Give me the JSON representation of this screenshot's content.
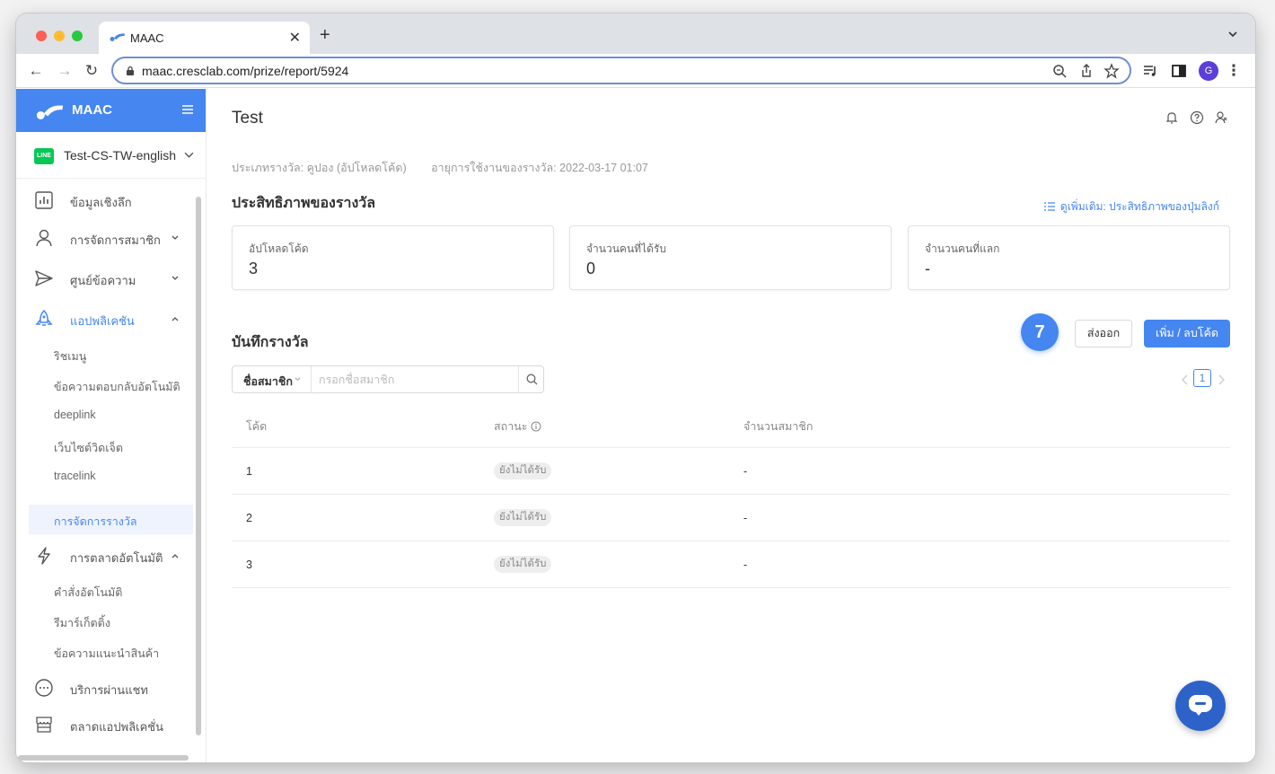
{
  "browser": {
    "tab_title": "MAAC",
    "url": "maac.cresclab.com/prize/report/5924",
    "profile_initial": "G"
  },
  "sidebar": {
    "brand": "MAAC",
    "account": "Test-CS-TW-english",
    "line_badge": "LINE",
    "items": [
      {
        "label": "ข้อมูลเชิงลึก",
        "icon": "bar-chart-icon"
      },
      {
        "label": "การจัดการสมาชิก",
        "icon": "user-icon"
      },
      {
        "label": "ศูนย์ข้อความ",
        "icon": "send-icon"
      },
      {
        "label": "แอปพลิเคชัน",
        "icon": "rocket-icon"
      },
      {
        "label": "การตลาดอัตโนมัติ",
        "icon": "lightning-icon"
      },
      {
        "label": "บริการผ่านแชท",
        "icon": "chat-icon"
      },
      {
        "label": "ตลาดแอปพลิเคชั่น",
        "icon": "store-icon"
      }
    ],
    "app_sub": [
      "ริชเมนู",
      "ข้อความตอบกลับอัตโนมัติ",
      "deeplink",
      "เว็บไซต์วิดเจ็ต",
      "tracelink",
      "การจัดการรางวัล"
    ],
    "auto_sub": [
      "คำสั่งอัตโนมัติ",
      "รีมาร์เก็ตติ้ง",
      "ข้อความแนะนำสินค้า"
    ]
  },
  "main": {
    "title": "Test",
    "meta_type": "ประเภทรางวัล: คูปอง (อัปโหลดโค้ด)",
    "meta_expiry": "อายุการใช้งานของรางวัล: 2022-03-17 01:07",
    "performance_title": "ประสิทธิภาพของรางวัล",
    "more_link": "ดูเพิ่มเติม: ประสิทธิภาพของปุ่มลิงก์",
    "cards": [
      {
        "label": "อัปโหลดโค้ด",
        "value": "3"
      },
      {
        "label": "จำนวนคนที่ได้รับ",
        "value": "0"
      },
      {
        "label": "จำนวนคนที่แลก",
        "value": "-"
      }
    ],
    "records_title": "บันทึกรางวัล",
    "step_badge": "7",
    "export_label": "ส่งออก",
    "add_remove_label": "เพิ่ม / ลบโค้ด",
    "search_field": "ชื่อสมาชิก",
    "search_placeholder": "กรอกชื่อสมาชิก",
    "current_page": "1",
    "columns": [
      "โค้ด",
      "สถานะ",
      "จำนวนสมาชิก"
    ],
    "rows": [
      {
        "code": "1",
        "status": "ยังไม่ได้รับ",
        "members": "-"
      },
      {
        "code": "2",
        "status": "ยังไม่ได้รับ",
        "members": "-"
      },
      {
        "code": "3",
        "status": "ยังไม่ได้รับ",
        "members": "-"
      }
    ]
  },
  "colors": {
    "accent": "#4586f0",
    "line_green": "#06c755",
    "chat_fab": "#2d63c8"
  }
}
